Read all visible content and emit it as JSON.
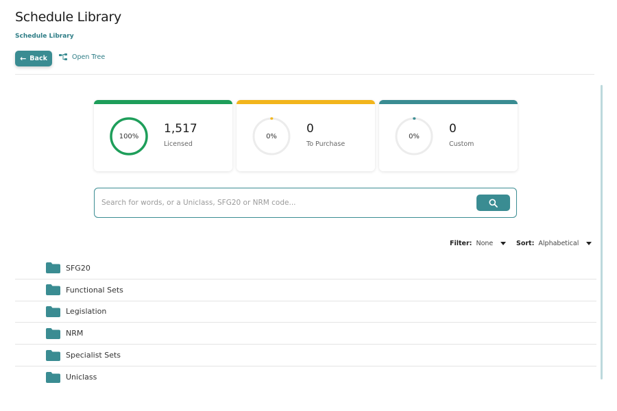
{
  "header": {
    "title": "Schedule Library",
    "breadcrumb": "Schedule Library",
    "back_label": "Back",
    "open_tree_label": "Open Tree"
  },
  "stats": [
    {
      "percent_label": "100%",
      "percent": 100,
      "value": "1,517",
      "label": "Licensed",
      "color": "#1e9e5a"
    },
    {
      "percent_label": "0%",
      "percent": 0,
      "value": "0",
      "label": "To Purchase",
      "color": "#f2b51c"
    },
    {
      "percent_label": "0%",
      "percent": 0,
      "value": "0",
      "label": "Custom",
      "color": "#3a8c92"
    }
  ],
  "search": {
    "placeholder": "Search for words, or a Uniclass, SFG20 or NRM code..."
  },
  "filter": {
    "label": "Filter:",
    "value": "None"
  },
  "sort": {
    "label": "Sort:",
    "value": "Alphabetical"
  },
  "folders": [
    {
      "label": "SFG20"
    },
    {
      "label": "Functional Sets"
    },
    {
      "label": "Legislation"
    },
    {
      "label": "NRM"
    },
    {
      "label": "Specialist Sets"
    },
    {
      "label": "Uniclass"
    }
  ],
  "colors": {
    "accent": "#3a8c92",
    "folder": "#3a8c92"
  }
}
